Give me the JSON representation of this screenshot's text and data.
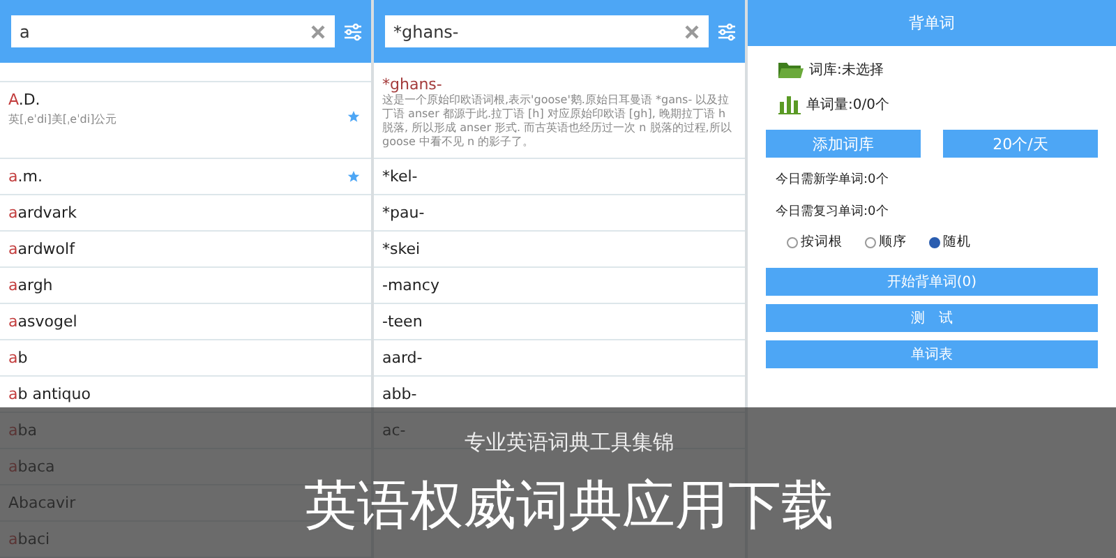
{
  "panels": [
    {
      "kind": "word_list",
      "search": {
        "value": "a"
      },
      "rows": [
        {
          "match": "A",
          "rest": ".D.",
          "phonetic": "英[ˌeˈdi]美[ˌeˈdi]公元",
          "starred": true
        },
        {
          "match": "a",
          "rest": ".m.",
          "starred": true
        },
        {
          "match": "a",
          "rest": "ardvark",
          "starred": false
        },
        {
          "match": "a",
          "rest": "ardwolf",
          "starred": false
        },
        {
          "match": "a",
          "rest": "argh",
          "starred": false
        },
        {
          "match": "a",
          "rest": "asvogel",
          "starred": false
        },
        {
          "match": "a",
          "rest": "b",
          "starred": false
        },
        {
          "match": "a",
          "rest": "b antiquo",
          "starred": false
        },
        {
          "match": "a",
          "rest": "ba",
          "starred": false
        },
        {
          "match": "a",
          "rest": "baca",
          "starred": false
        },
        {
          "match": "",
          "rest": "Abacavir",
          "starred": false
        },
        {
          "match": "a",
          "rest": "baci",
          "starred": false
        }
      ]
    },
    {
      "kind": "root_list",
      "search": {
        "value": "*ghans-"
      },
      "entry": {
        "word": "*ghans-",
        "description": "这是一个原始印欧语词根,表示'goose'鹅.原始日耳曼语 *gans- 以及拉丁语 anser 都源于此.拉丁语 [h] 对应原始印欧语 [gh], 晚期拉丁语 h 脱落, 所以形成 anser 形式. 而古英语也经历过一次 n 脱落的过程,所以 goose 中看不见 n 的影子了。"
      },
      "rows": [
        "*kel-",
        "*pau-",
        "*skei",
        "-mancy",
        "-teen",
        "aard-",
        "abb-",
        "ac-"
      ]
    },
    {
      "kind": "study",
      "title": "背单词",
      "library": "词库:未选择",
      "count": "单词量:0/0个",
      "buttons": [
        "添加词库",
        "20个/天"
      ],
      "stats": [
        "今日需新学单词:0个",
        "今日需复习单词:0个"
      ],
      "modes": [
        {
          "label": "按词根",
          "selected": false
        },
        {
          "label": "顺序",
          "selected": false
        },
        {
          "label": "随机",
          "selected": true
        }
      ],
      "actions": [
        "开始背单词(0)",
        "测　试",
        "单词表"
      ]
    }
  ],
  "banner": {
    "subtitle": "专业英语词典工具集锦",
    "title": "英语权威词典应用下载"
  }
}
